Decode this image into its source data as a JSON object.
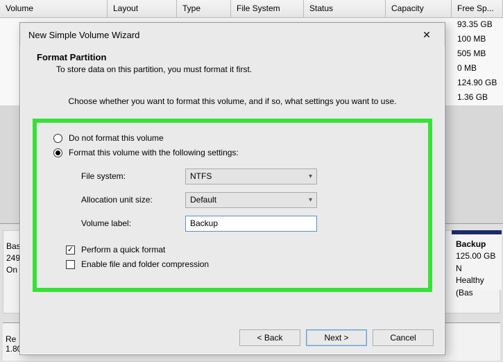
{
  "bg": {
    "headers": {
      "volume": "Volume",
      "layout": "Layout",
      "type": "Type",
      "filesystem": "File System",
      "status": "Status",
      "capacity": "Capacity",
      "free": "Free Sp..."
    },
    "free_values": [
      "93.35 GB",
      "100 MB",
      "505 MB",
      "0 MB",
      "124.90 GB",
      "1.36 GB"
    ],
    "disk_left": {
      "line1": "Bas",
      "line2": "249",
      "line3": "On"
    },
    "disk_left2": {
      "line1": "Re",
      "line2": "1.80"
    },
    "partition": {
      "name": "Backup",
      "size": "125.00 GB N",
      "status": "Healthy (Bas"
    }
  },
  "dialog": {
    "title": "New Simple Volume Wizard",
    "header": "Format Partition",
    "sub": "To store data on this partition, you must format it first.",
    "instruction": "Choose whether you want to format this volume, and if so, what settings you want to use.",
    "radio_no_format": "Do not format this volume",
    "radio_format": "Format this volume with the following settings:",
    "fs_label": "File system:",
    "fs_value": "NTFS",
    "aus_label": "Allocation unit size:",
    "aus_value": "Default",
    "vol_label": "Volume label:",
    "vol_value": "Backup",
    "quick_format": "Perform a quick format",
    "compression": "Enable file and folder compression",
    "back": "< Back",
    "next": "Next >",
    "cancel": "Cancel"
  }
}
